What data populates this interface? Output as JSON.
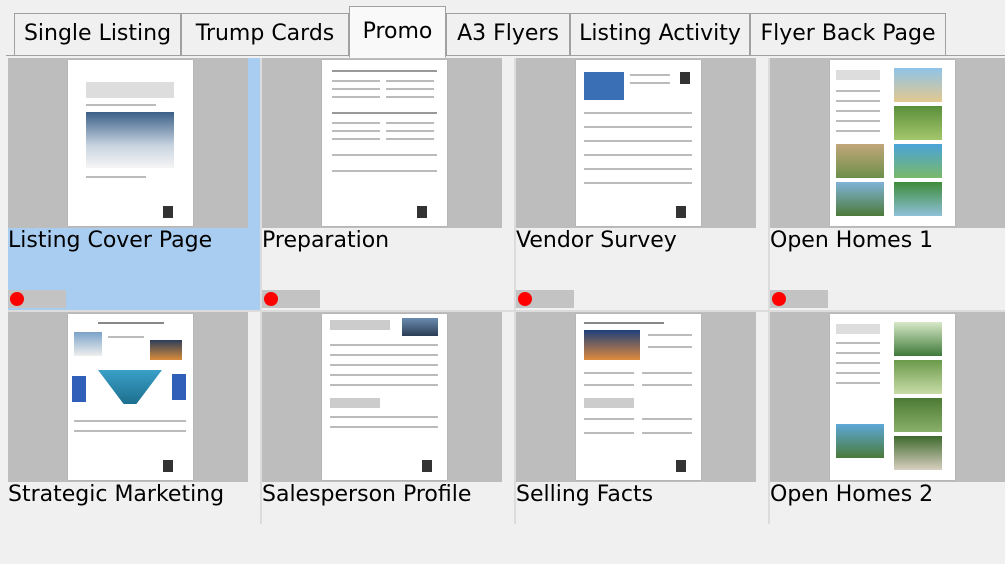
{
  "tabs": [
    {
      "label": "Single Listing",
      "active": false
    },
    {
      "label": "Trump Cards",
      "active": false
    },
    {
      "label": "Promo",
      "active": true
    },
    {
      "label": "A3 Flyers",
      "active": false
    },
    {
      "label": "Listing Activity",
      "active": false
    },
    {
      "label": "Flyer Back Page",
      "active": false
    }
  ],
  "tiles": [
    {
      "label": "Listing Cover Page",
      "selected": true,
      "status_indicator": "red"
    },
    {
      "label": "Preparation",
      "selected": false,
      "status_indicator": "red"
    },
    {
      "label": "Vendor Survey",
      "selected": false,
      "status_indicator": "red"
    },
    {
      "label": "Open Homes 1",
      "selected": false,
      "status_indicator": "red"
    },
    {
      "label": "Strategic Marketing",
      "selected": false
    },
    {
      "label": "Salesperson Profile",
      "selected": false
    },
    {
      "label": "Selling Facts",
      "selected": false
    },
    {
      "label": "Open Homes 2",
      "selected": false
    }
  ],
  "colors": {
    "selected_tile": "#a9cdf0",
    "status_dot": "#ff0000"
  }
}
